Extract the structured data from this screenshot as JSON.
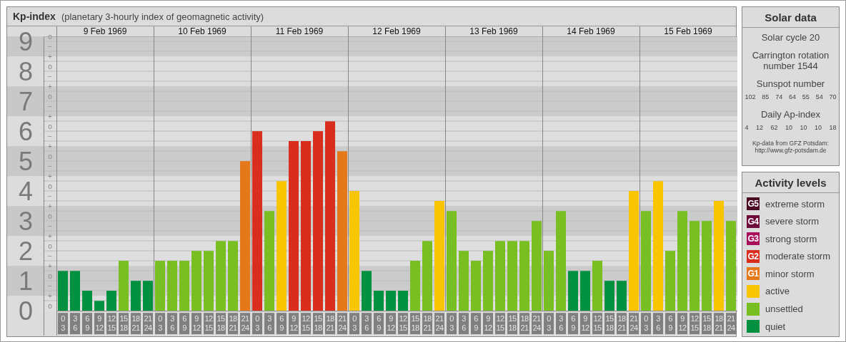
{
  "kp_panel": {
    "title": "Kp-index",
    "subtitle": "(planetary 3-hourly index of geomagnetic activity)",
    "days": [
      "9 Feb 1969",
      "10 Feb 1969",
      "11 Feb 1969",
      "12 Feb 1969",
      "13 Feb 1969",
      "14 Feb 1969",
      "15 Feb 1969"
    ],
    "kp_steps": [
      "o",
      "−",
      "+",
      "o",
      "−",
      "+",
      "o",
      "−",
      "+",
      "o",
      "−",
      "+",
      "o",
      "−",
      "+",
      "o",
      "−",
      "+",
      "o",
      "−",
      "+",
      "o",
      "−",
      "+",
      "o",
      "−",
      "+",
      "o"
    ],
    "chart_data": {
      "type": "bar",
      "ylim": [
        0,
        9.17
      ],
      "yticks": [
        0,
        1,
        2,
        3,
        4,
        5,
        6,
        7,
        8,
        9
      ],
      "grid": true,
      "bands": [
        {
          "axis": "y",
          "from": 0.5,
          "to": 1.5,
          "color": "#cbcbcb"
        },
        {
          "axis": "y",
          "from": 2.5,
          "to": 3.5,
          "color": "#cbcbcb"
        },
        {
          "axis": "y",
          "from": 4.5,
          "to": 5.5,
          "color": "#cbcbcb"
        },
        {
          "axis": "y",
          "from": 6.5,
          "to": 7.5,
          "color": "#cbcbcb"
        },
        {
          "axis": "y",
          "from": 8.5,
          "to": 9.17,
          "color": "#cbcbcb"
        }
      ],
      "categories": [
        "0 3",
        "3 6",
        "6 9",
        "9 12",
        "12 15",
        "15 18",
        "18 21",
        "21 24",
        "0 3",
        "3 6",
        "6 9",
        "9 12",
        "12 15",
        "15 18",
        "18 21",
        "21 24",
        "0 3",
        "3 6",
        "6 9",
        "9 12",
        "12 15",
        "15 18",
        "18 21",
        "21 24",
        "0 3",
        "3 6",
        "6 9",
        "9 12",
        "12 15",
        "15 18",
        "18 21",
        "21 24",
        "0 3",
        "3 6",
        "6 9",
        "9 12",
        "12 15",
        "15 18",
        "18 21",
        "21 24",
        "0 3",
        "3 6",
        "6 9",
        "9 12",
        "12 15",
        "15 18",
        "18 21",
        "21 24",
        "0 3",
        "3 6",
        "6 9",
        "9 12",
        "12 15",
        "15 18",
        "18 21",
        "21 24"
      ],
      "series": [
        {
          "values": [
            1.33,
            1.33,
            0.67,
            0.33,
            0.67,
            1.67,
            1,
            1,
            1.67,
            1.67,
            1.67,
            2,
            2,
            2.33,
            2.33,
            5,
            6,
            3.33,
            4.33,
            5.67,
            5.67,
            6,
            6.33,
            5.33,
            4,
            1.33,
            0.67,
            0.67,
            0.67,
            1.67,
            2.33,
            3.67,
            3.33,
            2,
            1.67,
            2,
            2.33,
            2.33,
            2.33,
            3,
            2,
            3.33,
            1.33,
            1.33,
            1.67,
            1,
            1,
            4,
            3.33,
            4.33,
            2,
            3.33,
            3,
            3,
            3.67,
            3
          ]
        }
      ]
    }
  },
  "solar_data": {
    "title": "Solar data",
    "cycle": "Solar cycle 20",
    "rotation": "Carrington rotation number 1544",
    "sunspot_label": "Sunspot number",
    "sunspots": [
      "102",
      "85",
      "74",
      "64",
      "55",
      "54",
      "70"
    ],
    "ap_label": "Daily Ap-index",
    "ap_values": [
      "4",
      "12",
      "62",
      "10",
      "10",
      "10",
      "18"
    ],
    "source": "Kp-data from GFZ Potsdam:",
    "source_url": "http://www.gfz-potsdam.de"
  },
  "legend": {
    "title": "Activity levels",
    "items": [
      {
        "badge": "G5",
        "label": "extreme storm",
        "color": "#4b0a24"
      },
      {
        "badge": "G4",
        "label": "severe storm",
        "color": "#6e0a3c"
      },
      {
        "badge": "G3",
        "label": "strong storm",
        "color": "#a8105c"
      },
      {
        "badge": "G2",
        "label": "moderate storm",
        "color": "#d92e1e"
      },
      {
        "badge": "G1",
        "label": "minor storm",
        "color": "#e57818"
      },
      {
        "label": "active",
        "color": "#f9c400"
      },
      {
        "label": "unsettled",
        "color": "#7abf22"
      },
      {
        "label": "quiet",
        "color": "#009140"
      }
    ]
  }
}
